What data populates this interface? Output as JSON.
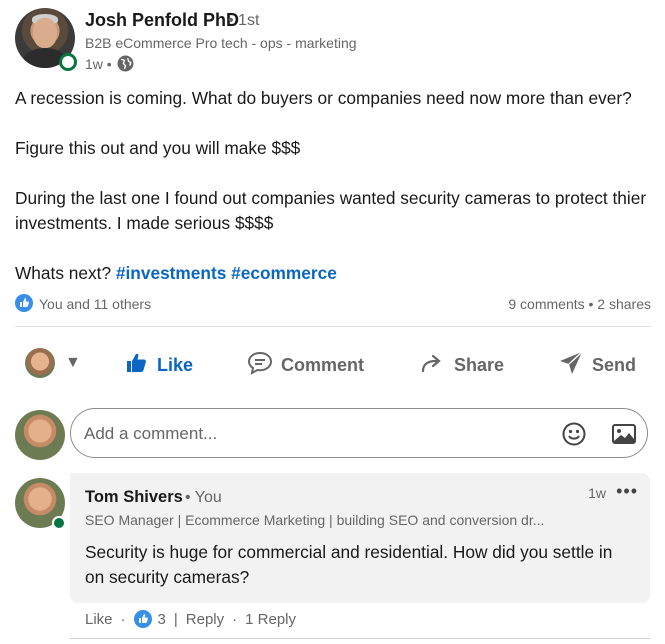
{
  "post": {
    "author_name": "Josh Penfold PhD",
    "degree": "• 1st",
    "headline": "B2B eCommerce Pro tech - ops - marketing",
    "time": "1w •",
    "body": {
      "p1": "A recession is coming. What do buyers or companies need now more than ever?",
      "p2": "Figure this out and you will make $$$",
      "p3": "During the last one I found out companies wanted security cameras to protect thier investments. I made serious $$$$",
      "p4_prefix": "Whats next?",
      "hashtag1": "#investments",
      "hashtag2": "#ecommerce"
    },
    "reactions_text": "You and 11 others",
    "counts_text": "9 comments • 2 shares"
  },
  "actions": {
    "like": "Like",
    "comment": "Comment",
    "share": "Share",
    "send": "Send"
  },
  "comment_input": {
    "placeholder": "Add a comment..."
  },
  "comment": {
    "name": "Tom Shivers",
    "you": "• You",
    "time": "1w",
    "more": "•••",
    "headline": "SEO Manager | Ecommerce Marketing | building SEO and conversion dr...",
    "text": "Security is huge for commercial and residential. How did you settle in on security cameras?",
    "like_label": "Like",
    "like_count": "3",
    "reply_label": "Reply",
    "reply_count": "1 Reply"
  },
  "colors": {
    "accent": "#0a66c2",
    "online": "#057642",
    "muted": "#666666"
  },
  "icons": [
    "globe-icon",
    "like-thumb-icon",
    "comment-icon",
    "share-icon",
    "send-icon",
    "emoji-icon",
    "image-icon",
    "caret-down-icon",
    "more-icon"
  ]
}
